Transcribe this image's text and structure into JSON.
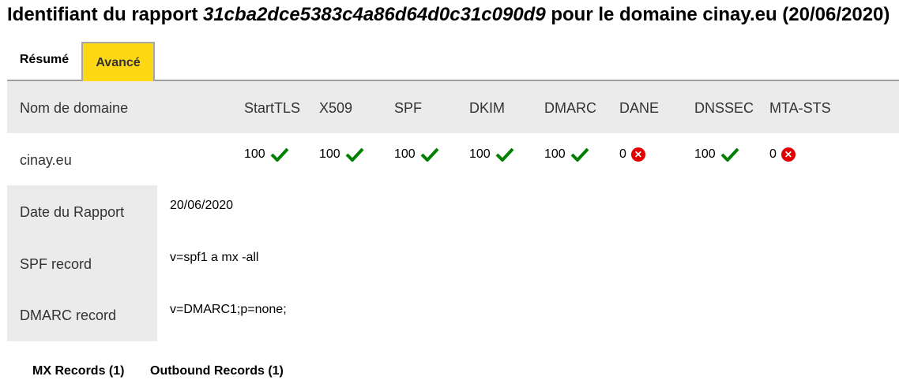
{
  "title": {
    "prefix": "Identifiant du rapport ",
    "report_id": "31cba2dce5383c4a86d64d0c31c090d9",
    "suffix": " pour le domaine cinay.eu (20/06/2020)"
  },
  "tabs": [
    {
      "label": "Résumé",
      "active": false
    },
    {
      "label": "Avancé",
      "active": true
    }
  ],
  "table": {
    "headers": [
      "Nom de domaine",
      "StartTLS",
      "X509",
      "SPF",
      "DKIM",
      "DMARC",
      "DANE",
      "DNSSEC",
      "MTA-STS"
    ],
    "domain": "cinay.eu",
    "scores": [
      {
        "value": "100",
        "status": "check-icon"
      },
      {
        "value": "100",
        "status": "check-icon"
      },
      {
        "value": "100",
        "status": "check-icon"
      },
      {
        "value": "100",
        "status": "check-icon"
      },
      {
        "value": "100",
        "status": "check-icon"
      },
      {
        "value": "0",
        "status": "cross-icon"
      },
      {
        "value": "100",
        "status": "check-icon"
      },
      {
        "value": "0",
        "status": "cross-icon"
      }
    ]
  },
  "details": [
    {
      "label": "Date du Rapport",
      "value": "20/06/2020"
    },
    {
      "label": "SPF record",
      "value": "v=spf1 a mx -all"
    },
    {
      "label": "DMARC record",
      "value": "v=DMARC1;p=none;"
    }
  ],
  "bottom_tabs": [
    "MX Records (1)",
    "Outbound Records (1)"
  ],
  "colors": {
    "active_tab": "#ffd814",
    "check": "#008000",
    "cross": "#e00000",
    "header_bg": "#ebebeb"
  }
}
